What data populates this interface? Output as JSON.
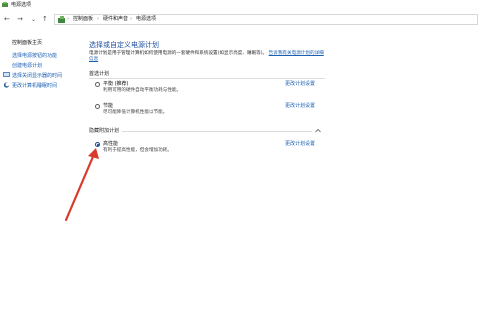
{
  "window": {
    "title": "电源选项",
    "icon": "power-options-icon"
  },
  "nav": {
    "back_icon": "back-arrow-icon",
    "forward_icon": "forward-arrow-icon",
    "dropdown_icon": "chevron-down-icon",
    "up_icon": "up-arrow-icon",
    "back": "←",
    "forward": "→",
    "dropdown": "⌄",
    "up": "↑",
    "sep": "›",
    "breadcrumbs": [
      "控制面板",
      "硬件和声音",
      "电源选项"
    ]
  },
  "sidebar": {
    "home": "控制面板主页",
    "items": [
      "选择电源按钮的功能",
      "创建电源计划",
      "选择关闭显示器的时间",
      "更改计算机睡眠时间"
    ]
  },
  "main": {
    "title": "选择或自定义电源计划",
    "description": "电源计划是用于管理计算机如何使用电源的一套硬件和系统设置(如显示亮度、睡眠等)。",
    "description_link": "告诉我有关电源计划的详细信息",
    "preferred_section": "首选计划",
    "hidden_section": "隐藏附加计划",
    "change_link": "更改计划设置",
    "plans": [
      {
        "name": "平衡 (推荐)",
        "desc": "利用可用的硬件自动平衡功耗与性能。",
        "selected": false
      },
      {
        "name": "节能",
        "desc": "尽可能降低计算机性能以节能。",
        "selected": false
      },
      {
        "name": "高性能",
        "desc": "有利于提高性能，但会增加功耗。",
        "selected": true
      }
    ]
  },
  "annotation": {
    "arrow_color": "#d93a2b"
  },
  "colors": {
    "link": "#1a5fb4",
    "heading": "#1e4f9c"
  }
}
